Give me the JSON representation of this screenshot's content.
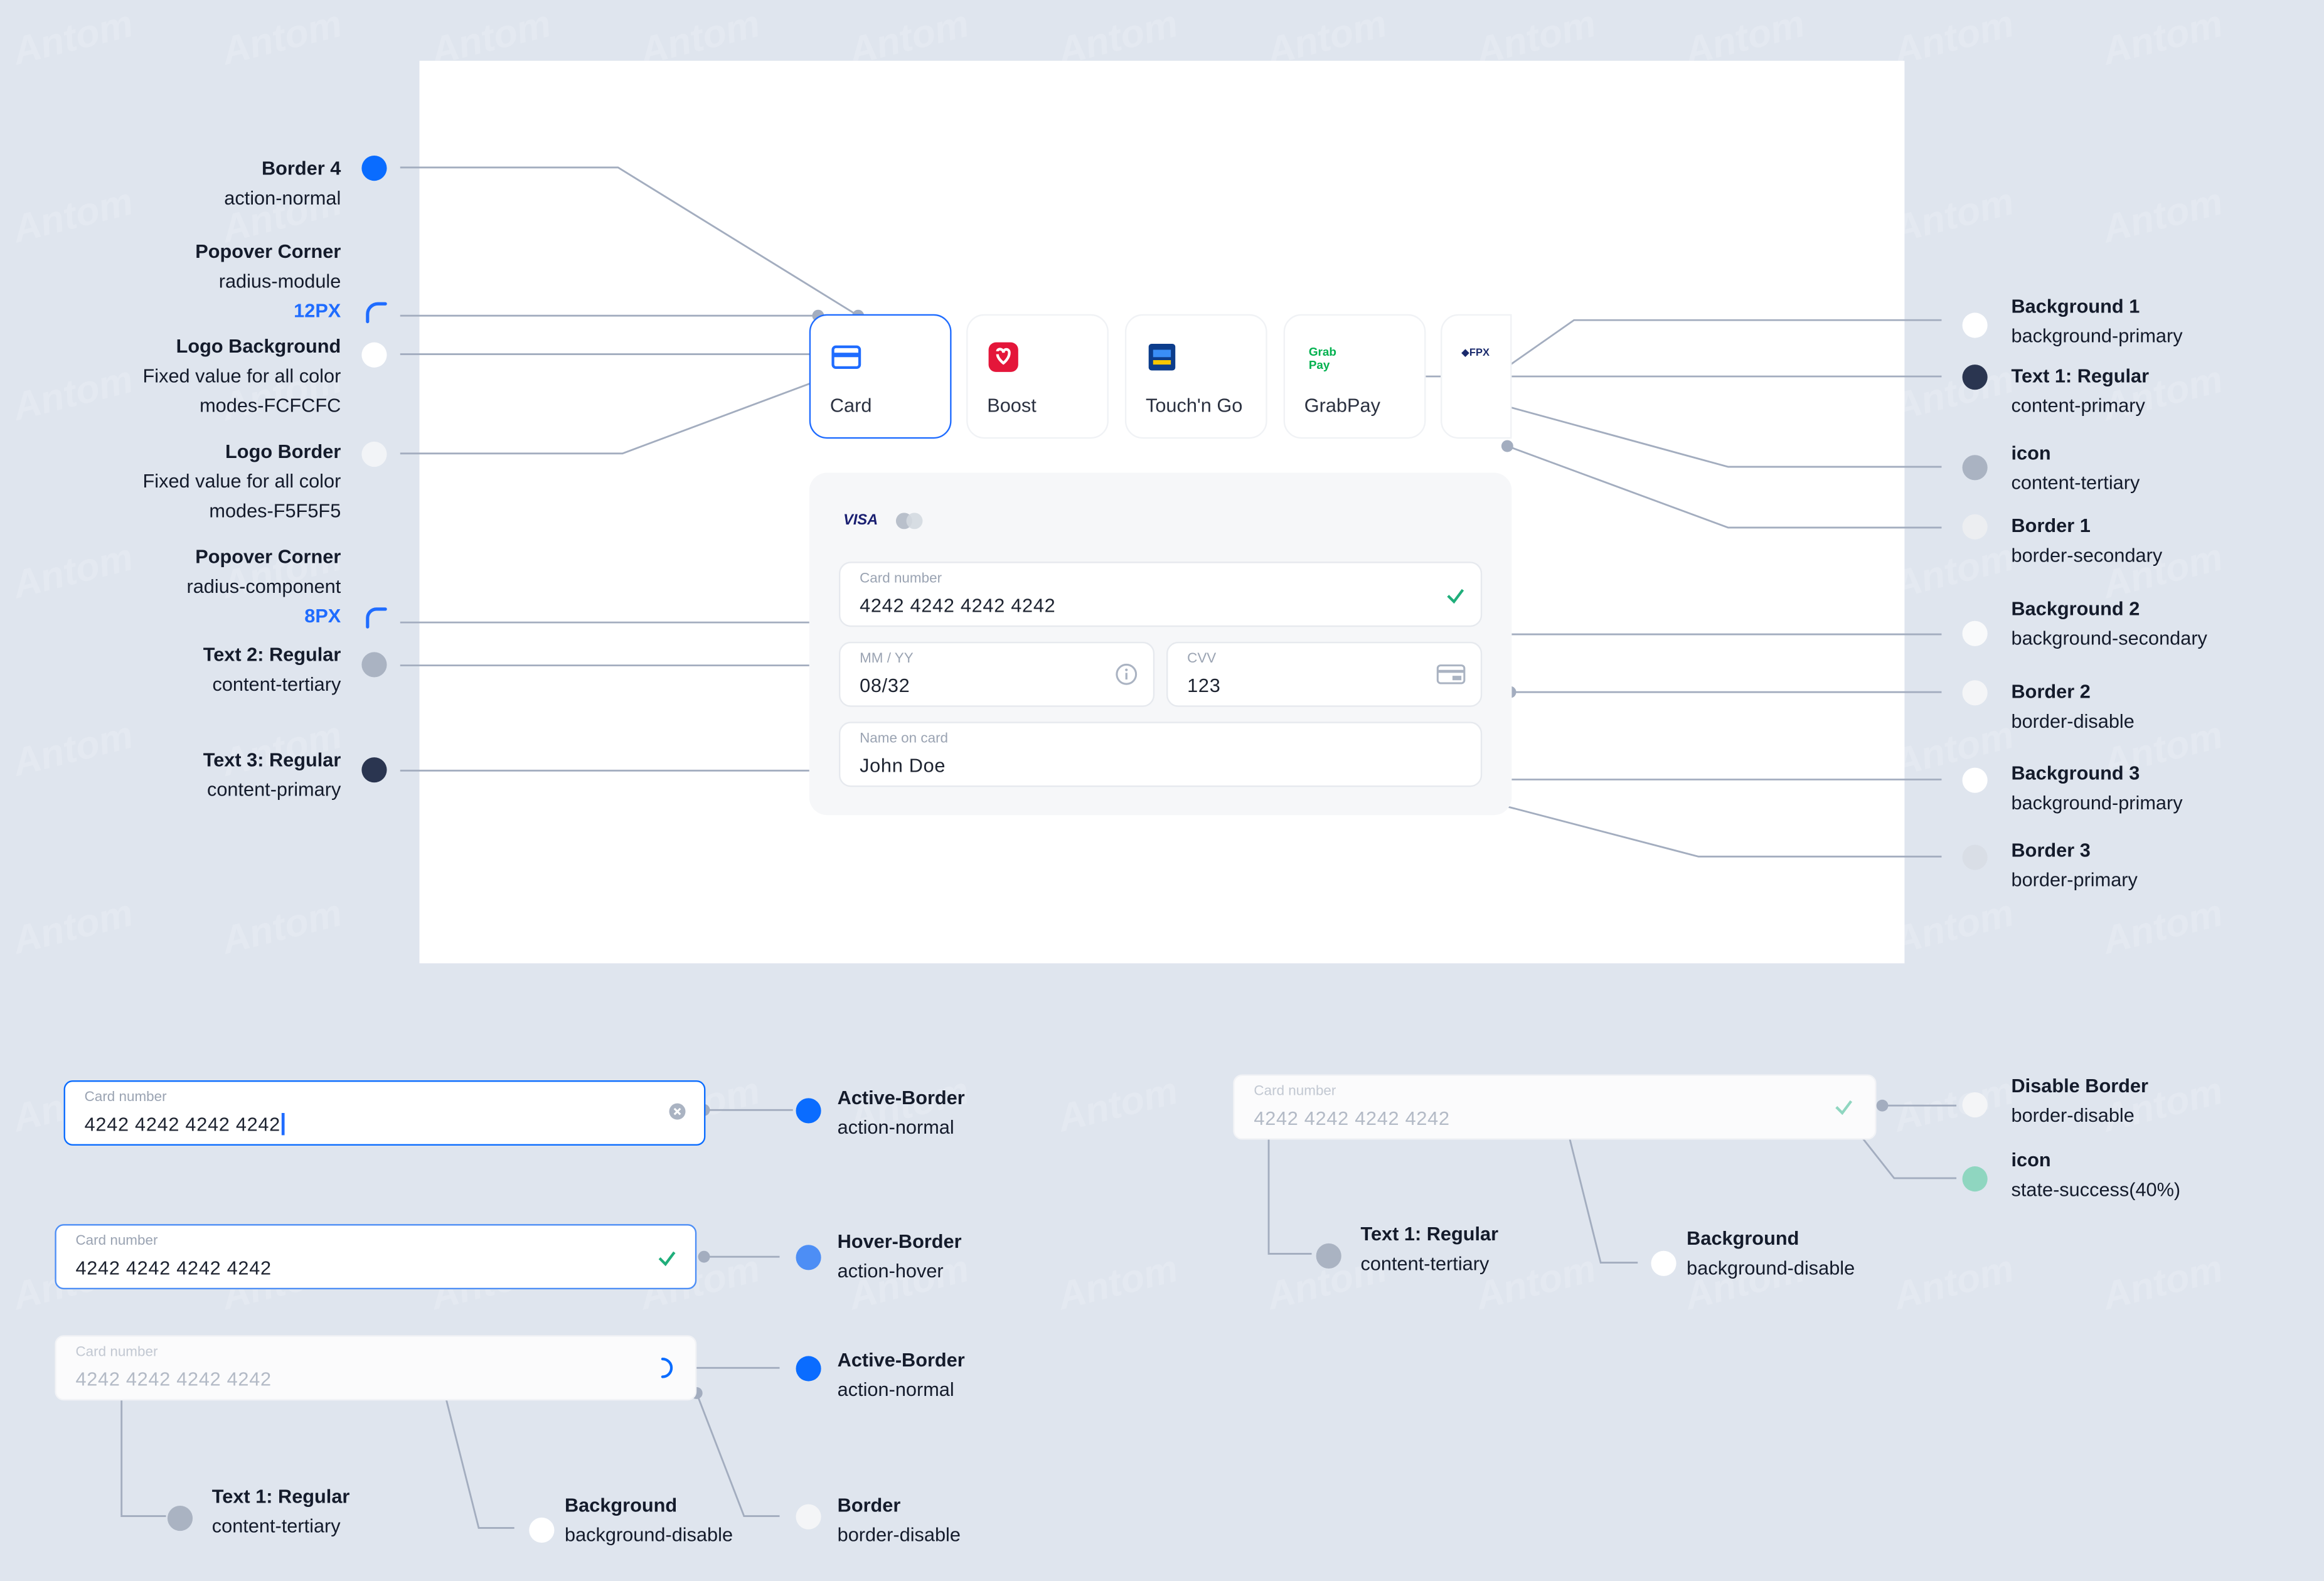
{
  "colors": {
    "action_normal": "#0a6cff",
    "action_hover": "#4d8ef5",
    "content_primary": "#2a3550",
    "content_tertiary": "#aab3c2",
    "white": "#ffffff",
    "border_secondary": "#eceef1",
    "success_40": "#8fd6c0",
    "line": "#a3adbf"
  },
  "watermark": "Antom",
  "left_labels": [
    {
      "title": "Border 4",
      "sub": "action-normal"
    },
    {
      "title": "Popover Corner",
      "sub": "radius-module",
      "px": "12PX"
    },
    {
      "title": "Logo Background",
      "sub": "Fixed value for all color",
      "sub2": "modes-FCFCFC"
    },
    {
      "title": "Logo Border",
      "sub": "Fixed value for all color",
      "sub2": "modes-F5F5F5"
    },
    {
      "title": "Popover Corner",
      "sub": "radius-component",
      "px": "8PX"
    },
    {
      "title": "Text 2: Regular",
      "sub": "content-tertiary"
    },
    {
      "title": "Text 3: Regular",
      "sub": "content-primary"
    }
  ],
  "right_labels": [
    {
      "title": "Background 1",
      "sub": "background-primary"
    },
    {
      "title": "Text 1: Regular",
      "sub": "content-primary"
    },
    {
      "title": "icon",
      "sub": "content-tertiary"
    },
    {
      "title": "Border 1",
      "sub": "border-secondary"
    },
    {
      "title": "Background 2",
      "sub": "background-secondary"
    },
    {
      "title": "Border 2",
      "sub": "border-disable"
    },
    {
      "title": "Background 3",
      "sub": "background-primary"
    },
    {
      "title": "Border 3",
      "sub": "border-primary"
    }
  ],
  "tabs": [
    {
      "label": "Card",
      "icon": "card-icon"
    },
    {
      "label": "Boost",
      "icon": "boost-logo-icon"
    },
    {
      "label": "Touch'n Go",
      "icon": "touchngo-logo-icon"
    },
    {
      "label": "GrabPay",
      "icon": "grabpay-logo-icon",
      "logo_text": "Grab Pay"
    },
    {
      "label": "",
      "icon": "fpx-logo-icon",
      "logo_text": "FPX"
    }
  ],
  "form": {
    "brand": "VISA",
    "card_label": "Card number",
    "card_value": "4242 4242 4242 4242",
    "exp_label": "MM / YY",
    "exp_value": "08/32",
    "cvv_label": "CVV",
    "cvv_value": "123",
    "name_label": "Name on card",
    "name_value": "John Doe"
  },
  "states": {
    "active": {
      "label": "Card number",
      "value": "4242 4242 4242 4242",
      "title": "Active-Border",
      "sub": "action-normal"
    },
    "hover": {
      "label": "Card number",
      "value": "4242 4242 4242 4242",
      "title": "Hover-Border",
      "sub": "action-hover"
    },
    "loading": {
      "label": "Card number",
      "value": "4242 4242 4242 4242",
      "title": "Active-Border",
      "sub": "action-normal"
    },
    "loading_notes": [
      {
        "title": "Text 1: Regular",
        "sub": "content-tertiary"
      },
      {
        "title": "Background",
        "sub": "background-disable"
      },
      {
        "title": "Border",
        "sub": "border-disable"
      }
    ],
    "disabled": {
      "label": "Card number",
      "value": "4242 4242 4242 4242"
    },
    "disabled_notes": [
      {
        "title": "Disable Border",
        "sub": "border-disable"
      },
      {
        "title": "icon",
        "sub": "state-success(40%)"
      },
      {
        "title": "Text 1: Regular",
        "sub": "content-tertiary"
      },
      {
        "title": "Background",
        "sub": "background-disable"
      }
    ]
  }
}
